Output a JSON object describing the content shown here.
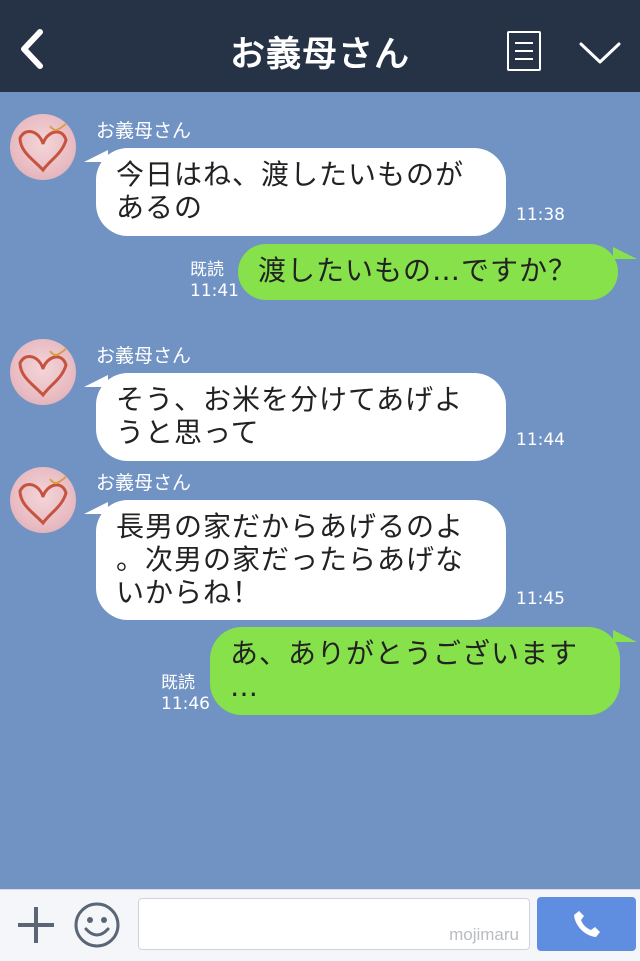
{
  "header": {
    "title": "お義母さん",
    "colors": {
      "background": "#263246",
      "text": "#ffffff"
    },
    "icons": [
      "back-icon",
      "menu-icon",
      "chevron-down-icon"
    ]
  },
  "chat": {
    "background": "#7193c4",
    "incoming_bubble_color": "#ffffff",
    "outgoing_bubble_color": "#86e14a",
    "messages": [
      {
        "direction": "in",
        "sender": "お義母さん",
        "text": "今日はね、渡したいものが\nあるの",
        "time": "11:38"
      },
      {
        "direction": "out",
        "read": "既読",
        "text": "渡したいもの…ですか？",
        "time": "11:41"
      },
      {
        "direction": "in",
        "sender": "お義母さん",
        "text": "そう、お米を分けてあげよ\nうと思って",
        "time": "11:44"
      },
      {
        "direction": "in",
        "sender": "お義母さん",
        "text": "長男の家だからあげるのよ\n。次男の家だったらあげな\nいからね！",
        "time": "11:45"
      },
      {
        "direction": "out",
        "read": "既読",
        "text": "あ、ありがとうございます\n…",
        "time": "11:46"
      }
    ]
  },
  "footer": {
    "input_value": "",
    "watermark": "mojimaru",
    "icons": [
      "plus-icon",
      "smile-icon",
      "phone-icon"
    ],
    "call_button_color": "#5f8ee0"
  }
}
